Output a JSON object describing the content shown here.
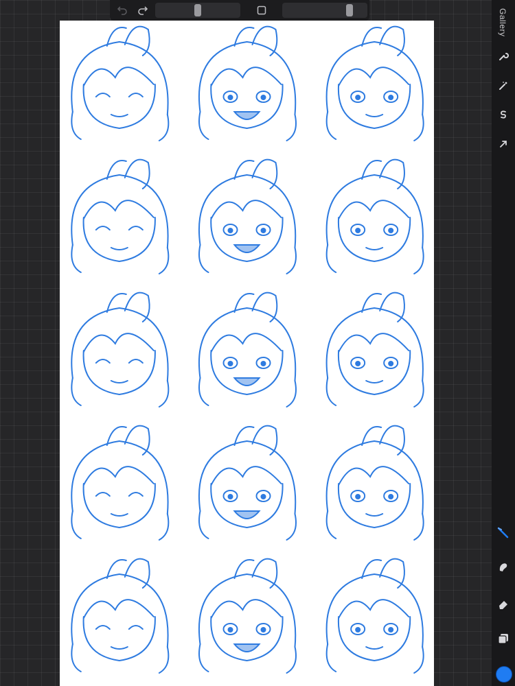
{
  "sidebar": {
    "gallery_label": "Gallery",
    "active_color": "#1f7cf2"
  },
  "topbar": {
    "icons": [
      "undo-icon",
      "redo-icon",
      "modify-square-icon"
    ]
  },
  "canvas": {
    "sketch_color": "#2e7be0",
    "grid": {
      "rows": 5,
      "cols": 3
    }
  }
}
